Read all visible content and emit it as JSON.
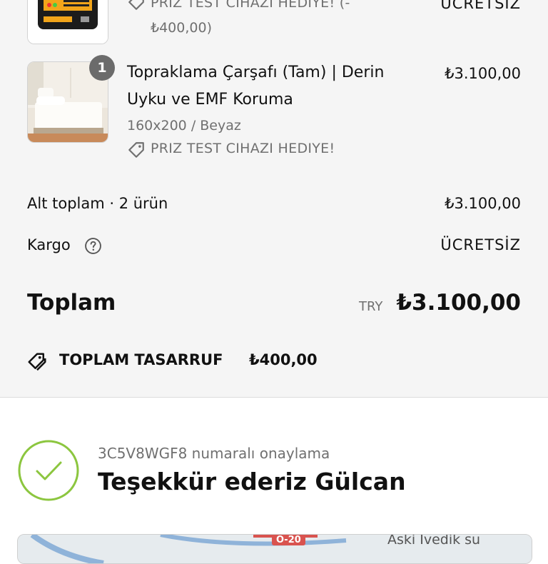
{
  "items": [
    {
      "discount_line1": "PRIZ TEST CIHAZI HEDIYE! (-",
      "discount_line2": "₺400,00)",
      "price": "ÜCRETSİZ"
    },
    {
      "quantity": "1",
      "title_line1": "Topraklama Çarşafı (Tam) | Derin",
      "title_line2": "Uyku ve EMF Koruma",
      "variant": "160x200 / Beyaz",
      "discount": "PRIZ TEST CIHAZI HEDIYE!",
      "price": "₺3.100,00"
    }
  ],
  "summary": {
    "subtotal_label": "Alt toplam · 2 ürün",
    "subtotal_value": "₺3.100,00",
    "shipping_label": "Kargo",
    "shipping_value": "ÜCRETSİZ",
    "total_label": "Toplam",
    "currency": "TRY",
    "total_value": "₺3.100,00",
    "savings_label": "TOPLAM TASARRUF",
    "savings_value": "₺400,00"
  },
  "confirmation": {
    "number_text": "3C5V8WGF8 numaralı onaylama",
    "thanks_text": "Teşekkür ederiz Gülcan"
  },
  "map": {
    "road_label": "O-20",
    "place_label": "Aski İvedik su"
  },
  "colors": {
    "check_green": "#8cc63f",
    "panel_bg": "#f5f5f5",
    "text_dark": "#111111",
    "text_muted": "#707070"
  },
  "icons": [
    "discount-tag-icon",
    "help-circle-icon",
    "savings-tag-icon",
    "check-icon"
  ]
}
